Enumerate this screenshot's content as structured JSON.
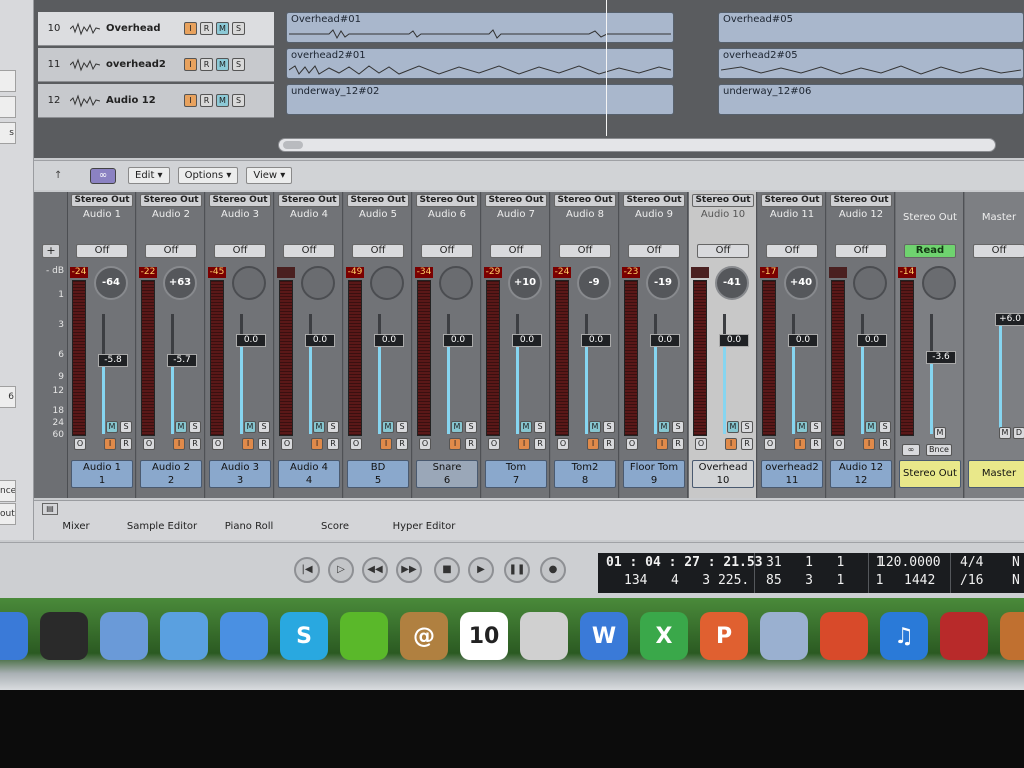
{
  "left_panel": {
    "buttons": [
      "s",
      "6",
      "nce",
      "out"
    ]
  },
  "arrange": {
    "tracks": [
      {
        "number": "10",
        "name": "Overhead",
        "buttons": [
          "I",
          "R",
          "M",
          "S"
        ]
      },
      {
        "number": "11",
        "name": "overhead2",
        "buttons": [
          "I",
          "R",
          "M",
          "S"
        ]
      },
      {
        "number": "12",
        "name": "Audio 12",
        "buttons": [
          "I",
          "R",
          "M",
          "S"
        ]
      }
    ],
    "regions": [
      "Overhead#01",
      "Overhead#05",
      "overhead2#01",
      "overhead2#05",
      "underway_12#02",
      "underway_12#06"
    ]
  },
  "mixer_toolbar": {
    "menus": [
      "Edit",
      "Options",
      "View"
    ]
  },
  "mixer_scale": {
    "labels": [
      "- dB",
      "1",
      "3",
      "6",
      "9",
      "12",
      "18",
      "24",
      "60"
    ]
  },
  "strips": [
    {
      "output": "Stereo Out",
      "name": "Audio 1",
      "auto": "Off",
      "peak": "-24",
      "pan": "-64",
      "fader": "-5.8",
      "fader_level": 0.62,
      "label": "Audio 1",
      "number": "1",
      "buttons": [
        "M",
        "S",
        "O",
        "I",
        "R"
      ]
    },
    {
      "output": "Stereo Out",
      "name": "Audio 2",
      "auto": "Off",
      "peak": "-22",
      "pan": "+63",
      "fader": "-5.7",
      "fader_level": 0.62,
      "label": "Audio 2",
      "number": "2",
      "buttons": [
        "M",
        "S",
        "O",
        "I",
        "R"
      ]
    },
    {
      "output": "Stereo Out",
      "name": "Audio 3",
      "auto": "Off",
      "peak": "-45",
      "pan": "",
      "fader": "0.0",
      "fader_level": 0.78,
      "label": "Audio 3",
      "number": "3",
      "buttons": [
        "M",
        "S",
        "O",
        "I",
        "R"
      ]
    },
    {
      "output": "Stereo Out",
      "name": "Audio 4",
      "auto": "Off",
      "peak": "",
      "pan": "",
      "fader": "0.0",
      "fader_level": 0.78,
      "label": "Audio 4",
      "number": "4",
      "buttons": [
        "M",
        "S",
        "O",
        "I",
        "R"
      ]
    },
    {
      "output": "Stereo Out",
      "name": "Audio 5",
      "auto": "Off",
      "peak": "-49",
      "pan": "",
      "fader": "0.0",
      "fader_level": 0.78,
      "label": "BD",
      "number": "5",
      "buttons": [
        "M",
        "S",
        "O",
        "I",
        "R"
      ]
    },
    {
      "output": "Stereo Out",
      "name": "Audio 6",
      "auto": "Off",
      "peak": "-34",
      "pan": "",
      "fader": "0.0",
      "fader_level": 0.78,
      "label": "Snare",
      "number": "6",
      "buttons": [
        "M",
        "S",
        "O",
        "I",
        "R"
      ]
    },
    {
      "output": "Stereo Out",
      "name": "Audio 7",
      "auto": "Off",
      "peak": "-29",
      "pan": "+10",
      "fader": "0.0",
      "fader_level": 0.78,
      "label": "Tom",
      "number": "7",
      "buttons": [
        "M",
        "S",
        "O",
        "I",
        "R"
      ]
    },
    {
      "output": "Stereo Out",
      "name": "Audio 8",
      "auto": "Off",
      "peak": "-24",
      "pan": "-9",
      "fader": "0.0",
      "fader_level": 0.78,
      "label": "Tom2",
      "number": "8",
      "buttons": [
        "M",
        "S",
        "O",
        "I",
        "R"
      ]
    },
    {
      "output": "Stereo Out",
      "name": "Audio 9",
      "auto": "Off",
      "peak": "-23",
      "pan": "-19",
      "fader": "0.0",
      "fader_level": 0.78,
      "label": "Floor Tom",
      "number": "9",
      "buttons": [
        "M",
        "S",
        "O",
        "I",
        "R"
      ]
    },
    {
      "output": "Stereo Out",
      "name": "Audio 10",
      "auto": "Off",
      "peak": "",
      "pan": "-41",
      "fader": "0.0",
      "fader_level": 0.78,
      "label": "Overhead",
      "number": "10",
      "buttons": [
        "M",
        "S",
        "O",
        "I",
        "R"
      ]
    },
    {
      "output": "Stereo Out",
      "name": "Audio 11",
      "auto": "Off",
      "peak": "-17",
      "pan": "+40",
      "fader": "0.0",
      "fader_level": 0.78,
      "label": "overhead2",
      "number": "11",
      "buttons": [
        "M",
        "S",
        "O",
        "I",
        "R"
      ]
    },
    {
      "output": "Stereo Out",
      "name": "Audio 12",
      "auto": "Off",
      "peak": "",
      "pan": "",
      "fader": "0.0",
      "fader_level": 0.78,
      "label": "Audio 12",
      "number": "12",
      "buttons": [
        "M",
        "S",
        "O",
        "I",
        "R"
      ]
    }
  ],
  "stereo_out": {
    "name": "Stereo Out",
    "auto": "Read",
    "peak": "-14",
    "fader": "-3.6",
    "fader_level": 0.64,
    "label": "Stereo Out",
    "buttons": [
      "M",
      "∞",
      "Bnce"
    ]
  },
  "master": {
    "name": "Master",
    "auto": "Off",
    "fader": "+6.0",
    "fader_level": 0.96,
    "label": "Master",
    "buttons": [
      "M",
      "D"
    ]
  },
  "mixer_tabs": [
    "Mixer",
    "Sample Editor",
    "Piano Roll",
    "Score",
    "Hyper Editor"
  ],
  "transport": {
    "buttons": [
      "go-to-start",
      "play-from-selection",
      "rewind",
      "fast-forward",
      "stop",
      "play",
      "pause",
      "record"
    ],
    "smpte": "01 : 04 : 27 : 21.53",
    "bars": [
      "134",
      "4",
      "3",
      "225."
    ],
    "locator1": [
      "31",
      "1",
      "1",
      "1"
    ],
    "locator2": [
      "85",
      "3",
      "1",
      "1"
    ],
    "tempo": "120.0000",
    "tempo2": "1442",
    "signature": "4/4",
    "division": "/16",
    "extra": "N"
  },
  "dock": {
    "items": [
      {
        "icon": "app-store-icon",
        "color": "#3a7ad8"
      },
      {
        "icon": "dashboard-icon",
        "color": "#2a2a2a"
      },
      {
        "icon": "mail-stamp-icon",
        "color": "#6a9ad8"
      },
      {
        "icon": "safari-icon",
        "color": "#5aa0e0"
      },
      {
        "icon": "ichat-icon",
        "color": "#4a90e2"
      },
      {
        "icon": "skype-icon",
        "color": "#29a8e0",
        "glyph": "S"
      },
      {
        "icon": "frog-icon",
        "color": "#5ab82a"
      },
      {
        "icon": "address-book-icon",
        "color": "#b08040",
        "glyph": "@"
      },
      {
        "icon": "ical-icon",
        "color": "#ffffff",
        "glyph": "10"
      },
      {
        "icon": "iphoto-icon",
        "color": "#d0d0d0"
      },
      {
        "icon": "word-icon",
        "color": "#3a7ad8",
        "glyph": "W"
      },
      {
        "icon": "excel-icon",
        "color": "#3aa84a",
        "glyph": "X"
      },
      {
        "icon": "powerpoint-icon",
        "color": "#e06030",
        "glyph": "P"
      },
      {
        "icon": "entourage-icon",
        "color": "#9ab0d0"
      },
      {
        "icon": "keynote-icon",
        "color": "#d84a2a"
      },
      {
        "icon": "itunes-icon",
        "color": "#2a7ad8",
        "glyph": "♫"
      },
      {
        "icon": "photo-booth-icon",
        "color": "#b82a2a"
      },
      {
        "icon": "preview-icon",
        "color": "#c07030"
      }
    ]
  }
}
